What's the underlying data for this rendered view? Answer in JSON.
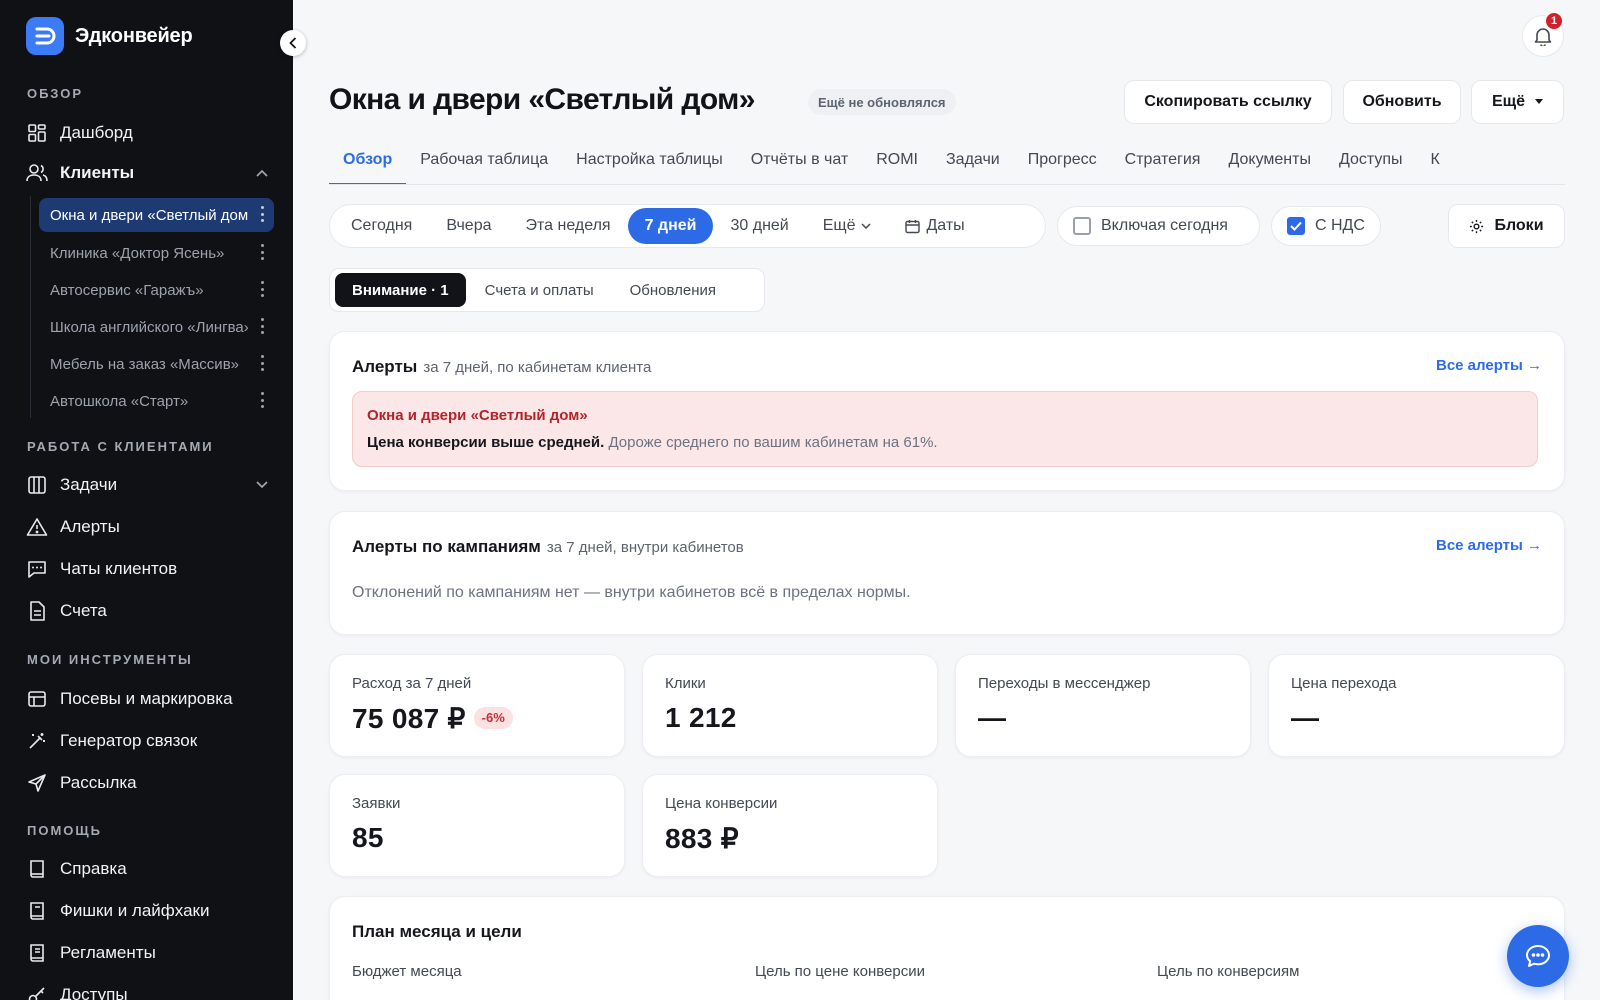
{
  "app": {
    "name": "Эдконвейер"
  },
  "sidebar": {
    "sections": {
      "overview": "Обзор",
      "work": "Работа с клиентами",
      "tools": "Мои инструменты",
      "help": "Помощь"
    },
    "overview_items": [
      {
        "label": "Дашборд",
        "icon": "dashboard-icon"
      },
      {
        "label": "Клиенты",
        "icon": "users-icon"
      }
    ],
    "clients": [
      "Окна и двери «Светлый дом»",
      "Клиника «Доктор Ясень»",
      "Автосервис «Гаражъ»",
      "Школа английского «Лингва»",
      "Мебель на заказ «Массив»",
      "Автошкола «Старт»"
    ],
    "work_items": [
      {
        "label": "Задачи",
        "icon": "tasks-icon"
      },
      {
        "label": "Алерты",
        "icon": "warning-icon"
      },
      {
        "label": "Чаты клиентов",
        "icon": "chat-icon"
      },
      {
        "label": "Счета",
        "icon": "document-icon"
      }
    ],
    "tool_items": [
      {
        "label": "Посевы и маркировка",
        "icon": "layout-icon"
      },
      {
        "label": "Генератор связок",
        "icon": "magic-wand-icon"
      },
      {
        "label": "Рассылка",
        "icon": "send-icon"
      }
    ],
    "help_items": [
      {
        "label": "Справка",
        "icon": "book-icon"
      },
      {
        "label": "Фишки и лайфхаки",
        "icon": "book-icon"
      },
      {
        "label": "Регламенты",
        "icon": "book-icon"
      },
      {
        "label": "Доступы",
        "icon": "key-icon"
      }
    ]
  },
  "header": {
    "title": "Окна и двери «Светлый дом»",
    "status": "Ещё не обновлялся",
    "copy_link": "Скопировать ссылку",
    "refresh": "Обновить",
    "more": "Ещё",
    "notifications_count": "1"
  },
  "tabs": [
    "Обзор",
    "Рабочая таблица",
    "Настройка таблицы",
    "Отчёты в чат",
    "ROMI",
    "Задачи",
    "Прогресс",
    "Стратегия",
    "Документы",
    "Доступы",
    "К"
  ],
  "filters": {
    "periods": [
      "Сегодня",
      "Вчера",
      "Эта неделя",
      "7 дней",
      "30 дней"
    ],
    "more": "Ещё",
    "dates": "Даты",
    "include_today": "Включая сегодня",
    "vat": "С НДС",
    "blocks": "Блоки"
  },
  "subtabs": [
    "Внимание · 1",
    "Счета и оплаты",
    "Обновления"
  ],
  "alerts": {
    "title": "Алерты",
    "subtitle": "за 7 дней, по кабинетам клиента",
    "link": "Все алерты →",
    "item_title": "Окна и двери «Светлый дом»",
    "item_bold": "Цена конверсии выше средней.",
    "item_text": "Дороже среднего по вашим кабинетам на 61%."
  },
  "campaign_alerts": {
    "title": "Алерты по кампаниям",
    "subtitle": "за 7 дней, внутри кабинетов",
    "link": "Все алерты →",
    "note": "Отклонений по кампаниям нет — внутри кабинетов всё в пределах нормы."
  },
  "kpis": {
    "spend_label": "Расход за 7 дней",
    "spend_value": "75 087 ₽",
    "spend_delta": "-6%",
    "clicks_label": "Клики",
    "clicks_value": "1 212",
    "messenger_label": "Переходы в мессенджер",
    "messenger_value": "—",
    "cpc_label": "Цена перехода",
    "cpc_value": "—",
    "leads_label": "Заявки",
    "leads_value": "85",
    "cpa_label": "Цена конверсии",
    "cpa_value": "883 ₽"
  },
  "plan": {
    "title": "План месяца и цели",
    "budget_label": "Бюджет месяца",
    "cpa_goal_label": "Цель по цене конверсии",
    "conv_goal_label": "Цель по конверсиям"
  },
  "colors": {
    "accent": "#2d6be6",
    "sidebar": "#0f1115",
    "danger": "#d0202a"
  }
}
